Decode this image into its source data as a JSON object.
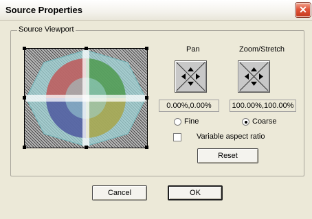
{
  "window": {
    "title": "Source Properties",
    "close_glyph": "✕"
  },
  "group": {
    "label": "Source Viewport"
  },
  "pan": {
    "label": "Pan",
    "value": "0.00%,0.00%"
  },
  "zoom": {
    "label": "Zoom/Stretch",
    "value": "100.00%,100.00%"
  },
  "precision": {
    "fine_label": "Fine",
    "coarse_label": "Coarse",
    "selected": "Coarse"
  },
  "aspect": {
    "label": "Variable aspect ratio",
    "checked": false
  },
  "buttons": {
    "reset": "Reset",
    "cancel": "Cancel",
    "ok": "OK"
  },
  "colors": {
    "quad_red": "#c05a5a",
    "quad_green": "#4f9a4f",
    "quad_blue": "#4f5aa0",
    "quad_yellow": "#a8a64a",
    "hex_fill": "#9fd3d6",
    "close_red": "#d8492c"
  },
  "icons": [
    "close-icon",
    "pan-arrows-icon",
    "zoom-arrows-icon"
  ]
}
